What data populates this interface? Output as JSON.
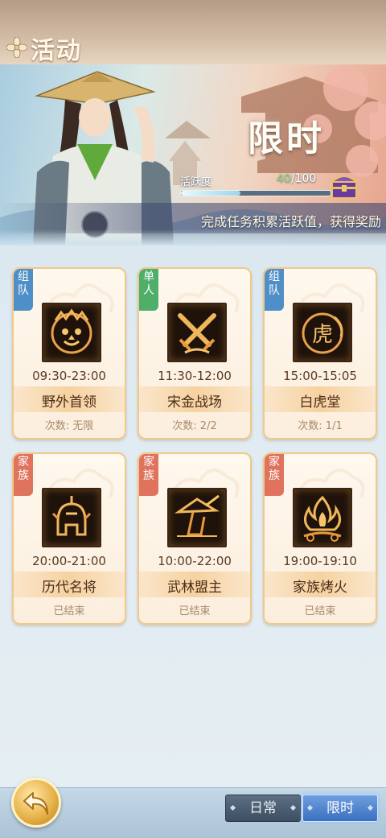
{
  "header": {
    "title": "活动"
  },
  "banner": {
    "title": "限时",
    "activity_label": "活跃度",
    "activity_current": "40",
    "activity_max": "/100",
    "activity_progress": 0.4,
    "description": "完成任务积累活跃值，获得奖励"
  },
  "cards": [
    {
      "tag": "组队",
      "tag_type": "team",
      "icon": "lion-mask-icon",
      "time": "09:30-23:00",
      "name": "野外首领",
      "count": "次数: 无限"
    },
    {
      "tag": "单人",
      "tag_type": "solo",
      "icon": "crossed-swords-icon",
      "time": "11:30-12:00",
      "name": "宋金战场",
      "count": "次数: 2/2"
    },
    {
      "tag": "组队",
      "tag_type": "team",
      "icon": "tiger-seal-icon",
      "time": "15:00-15:05",
      "name": "白虎堂",
      "count": "次数: 1/1"
    },
    {
      "tag": "家族",
      "tag_type": "family",
      "icon": "helmet-icon",
      "time": "20:00-21:00",
      "name": "历代名将",
      "count": "已结束"
    },
    {
      "tag": "家族",
      "tag_type": "family",
      "icon": "swordsman-hat-icon",
      "time": "10:00-22:00",
      "name": "武林盟主",
      "count": "已结束"
    },
    {
      "tag": "家族",
      "tag_type": "family",
      "icon": "bonfire-icon",
      "time": "19:00-19:10",
      "name": "家族烤火",
      "count": "已结束"
    }
  ],
  "icons": {
    "tiger_char": "虎"
  },
  "bottom": {
    "back_icon": "back-arrow-icon",
    "tab_daily": "日常",
    "tab_limited": "限时",
    "active_tab": "限时"
  },
  "colors": {
    "tag_team": "#4f8fc7",
    "tag_solo": "#4fae6a",
    "tag_family": "#e0735e",
    "card_border": "#f1c88a"
  }
}
